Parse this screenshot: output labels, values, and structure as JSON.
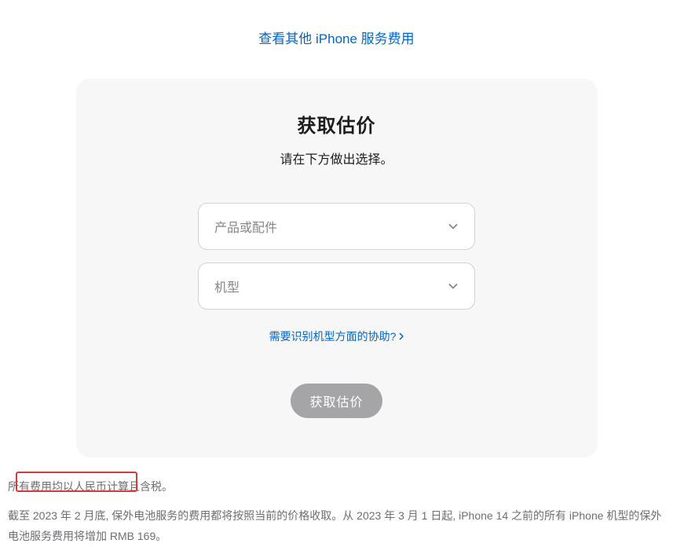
{
  "header": {
    "top_link_text": "查看其他 iPhone 服务费用"
  },
  "card": {
    "title": "获取估价",
    "subtitle": "请在下方做出选择。",
    "select_product_placeholder": "产品或配件",
    "select_model_placeholder": "机型",
    "help_link_text": "需要识别机型方面的协助?",
    "button_label": "获取估价"
  },
  "footer": {
    "line1": "所有费用均以人民币计算且含税。",
    "line2": "截至 2023 年 2 月底, 保外电池服务的费用都将按照当前的价格收取。从 2023 年 3 月 1 日起, iPhone 14 之前的所有 iPhone 机型的保外电池服务费用将增加 RMB 169。"
  }
}
